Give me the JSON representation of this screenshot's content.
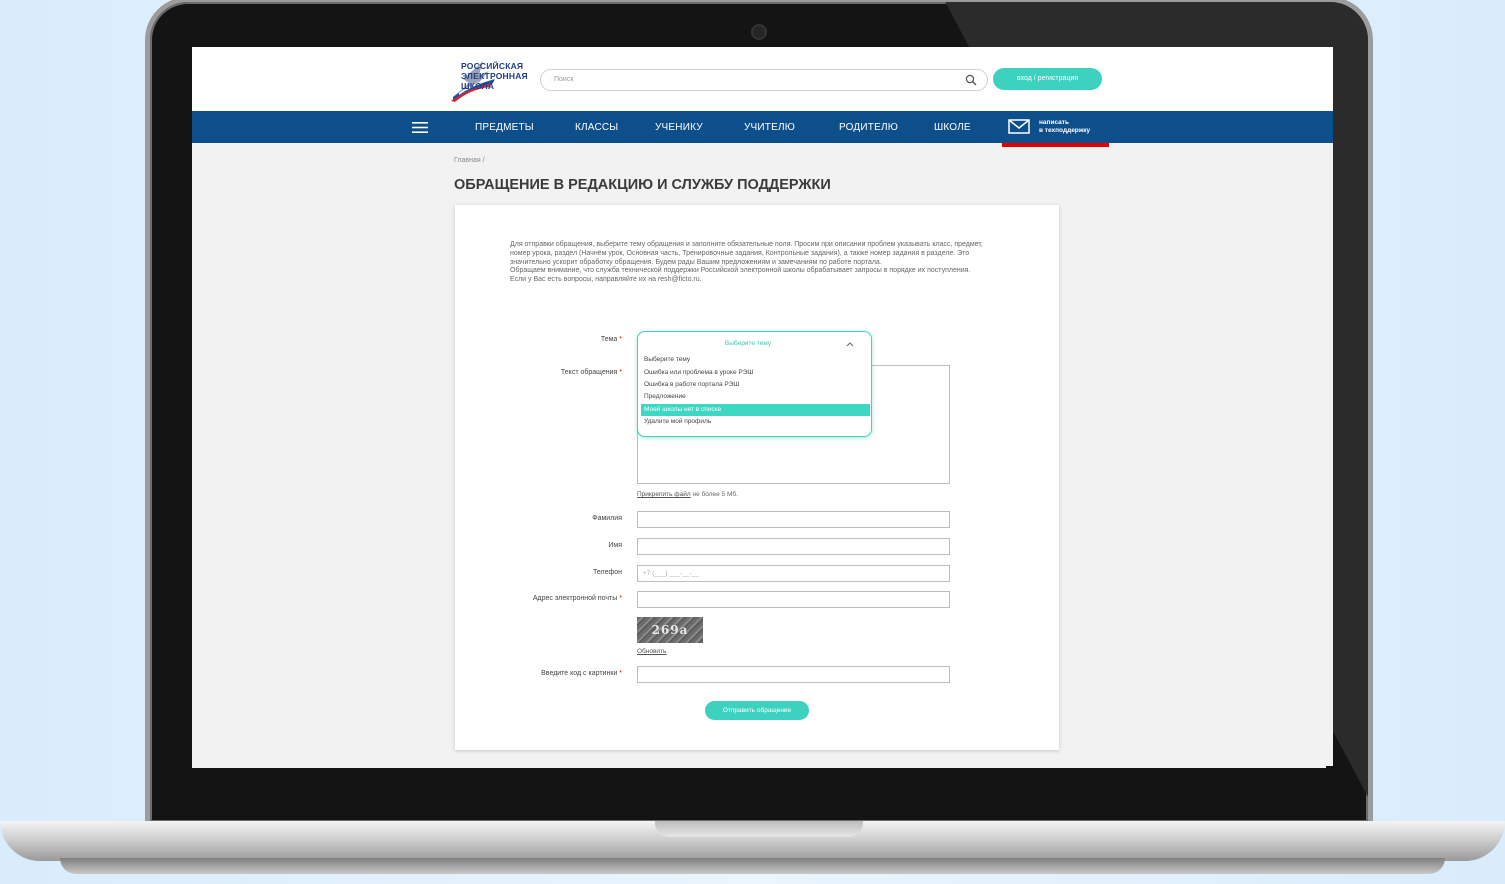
{
  "header": {
    "logo_lines": [
      "РОССИЙСКАЯ",
      "ЭЛЕКТРОННАЯ",
      "ШКОЛА"
    ],
    "search_placeholder": "Поиск",
    "login_label": "вход / регистрация"
  },
  "nav": {
    "items": [
      "ПРЕДМЕТЫ",
      "КЛАССЫ",
      "УЧЕНИКУ",
      "УЧИТЕЛЮ",
      "РОДИТЕЛЮ",
      "ШКОЛЕ"
    ],
    "support_line1": "написать",
    "support_line2": "в техподдержку"
  },
  "breadcrumb": "Главная /",
  "page_title": "ОБРАЩЕНИЕ В РЕДАКЦИЮ И СЛУЖБУ ПОДДЕРЖКИ",
  "intro": {
    "p1": "Для отправки обращения, выберите тему обращения и заполните обязательные поля. Просим при описании проблем указывать класс, предмет, номер урока, раздел (Начнём урок, Основная часть, Тренировочные задания, Контрольные задания), а также номер задания в разделе. Это значительно ускорит обработку обращения. Будем рады Вашим предложениям и замечаниям по работе портала.",
    "p2": "Обращаем внимание, что служба технической поддержки Российской электронной школы обрабатывает запросы в порядке их поступления.",
    "p3": "Если у Вас есть вопросы, направляйте их на resh@ficto.ru."
  },
  "form": {
    "topic_label": "Тема",
    "text_label": "Текст обращения",
    "required_mark": "*",
    "attach_link": "Прикрепить файл",
    "attach_note": " не более 5 Мб.",
    "last_name_label": "Фамилия",
    "first_name_label": "Имя",
    "phone_label": "Телефон",
    "phone_placeholder": "+7 (___) ___-__-__",
    "email_label": "Адрес электронной почты",
    "captcha_text": "269а",
    "refresh_label": "Обновить",
    "captcha_label": "Введите код с картинки",
    "submit_label": "Отправить обращение"
  },
  "dropdown": {
    "selected": "Выберите тему",
    "options": [
      "Выберите тему",
      "Ошибка или проблема в уроке РЭШ",
      "Ошибка в работе портала РЭШ",
      "Предложение",
      "Моей школы нет в списке",
      "Удалите мой профиль"
    ],
    "highlighted_index": 4
  },
  "colors": {
    "accent": "#3dd2c0",
    "nav": "#0d4f8b",
    "title": "#3b3b3b",
    "required": "#e00000"
  }
}
